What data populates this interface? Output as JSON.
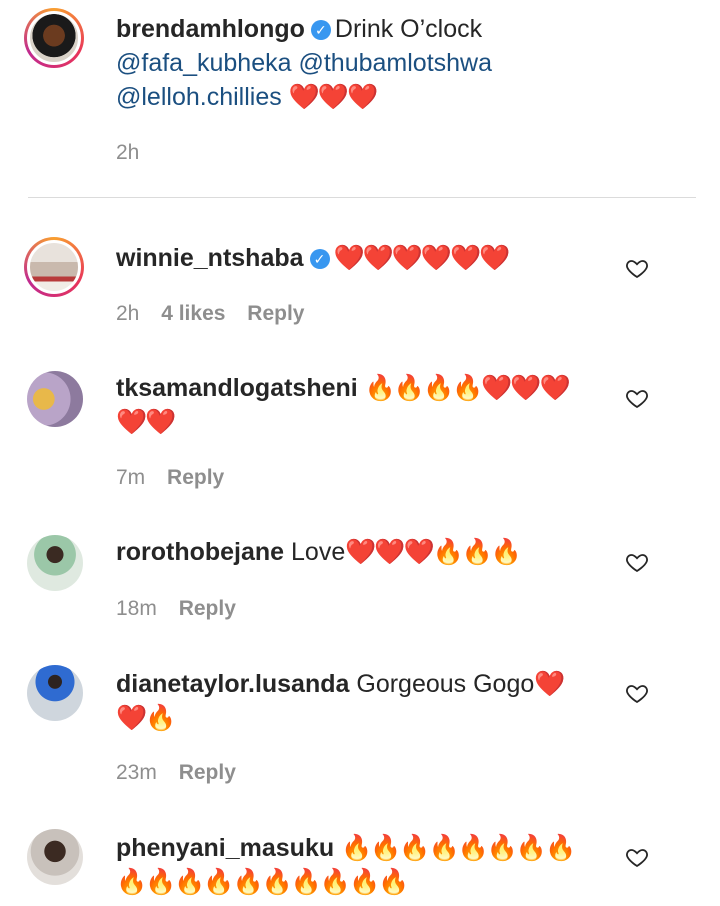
{
  "caption": {
    "username": "brendamhlongo",
    "text": "Drink O’clock",
    "mention1": "@fafa_kubheka",
    "mention2": "@thubamlotshwa",
    "mention3": "@lelloh.chillies",
    "emoji": "❤️❤️❤️",
    "time": "2h"
  },
  "comments": [
    {
      "username": "winnie_ntshaba",
      "text": "",
      "emoji": "❤️❤️❤️❤️❤️❤️",
      "time": "2h",
      "likes": "4 likes",
      "reply": "Reply"
    },
    {
      "username": "tksamandlogatsheni",
      "text": "",
      "emoji": "🔥🔥🔥🔥❤️❤️❤️",
      "emoji2": "❤️❤️",
      "time": "7m",
      "reply": "Reply"
    },
    {
      "username": "rorothobejane",
      "text": "Love",
      "emoji": "❤️❤️❤️🔥🔥🔥",
      "time": "18m",
      "reply": "Reply"
    },
    {
      "username": "dianetaylor.lusanda",
      "text": "Gorgeous Gogo",
      "emoji": "❤️",
      "emoji2": "❤️🔥",
      "time": "23m",
      "reply": "Reply"
    },
    {
      "username": "phenyani_masuku",
      "text": "",
      "emoji": "🔥🔥🔥🔥🔥🔥🔥🔥",
      "emoji2": "🔥🔥🔥🔥🔥🔥🔥🔥🔥🔥"
    }
  ],
  "colors": {
    "verified": "#3897f0",
    "mention": "#1b4f80",
    "meta": "#8e8e8e"
  }
}
